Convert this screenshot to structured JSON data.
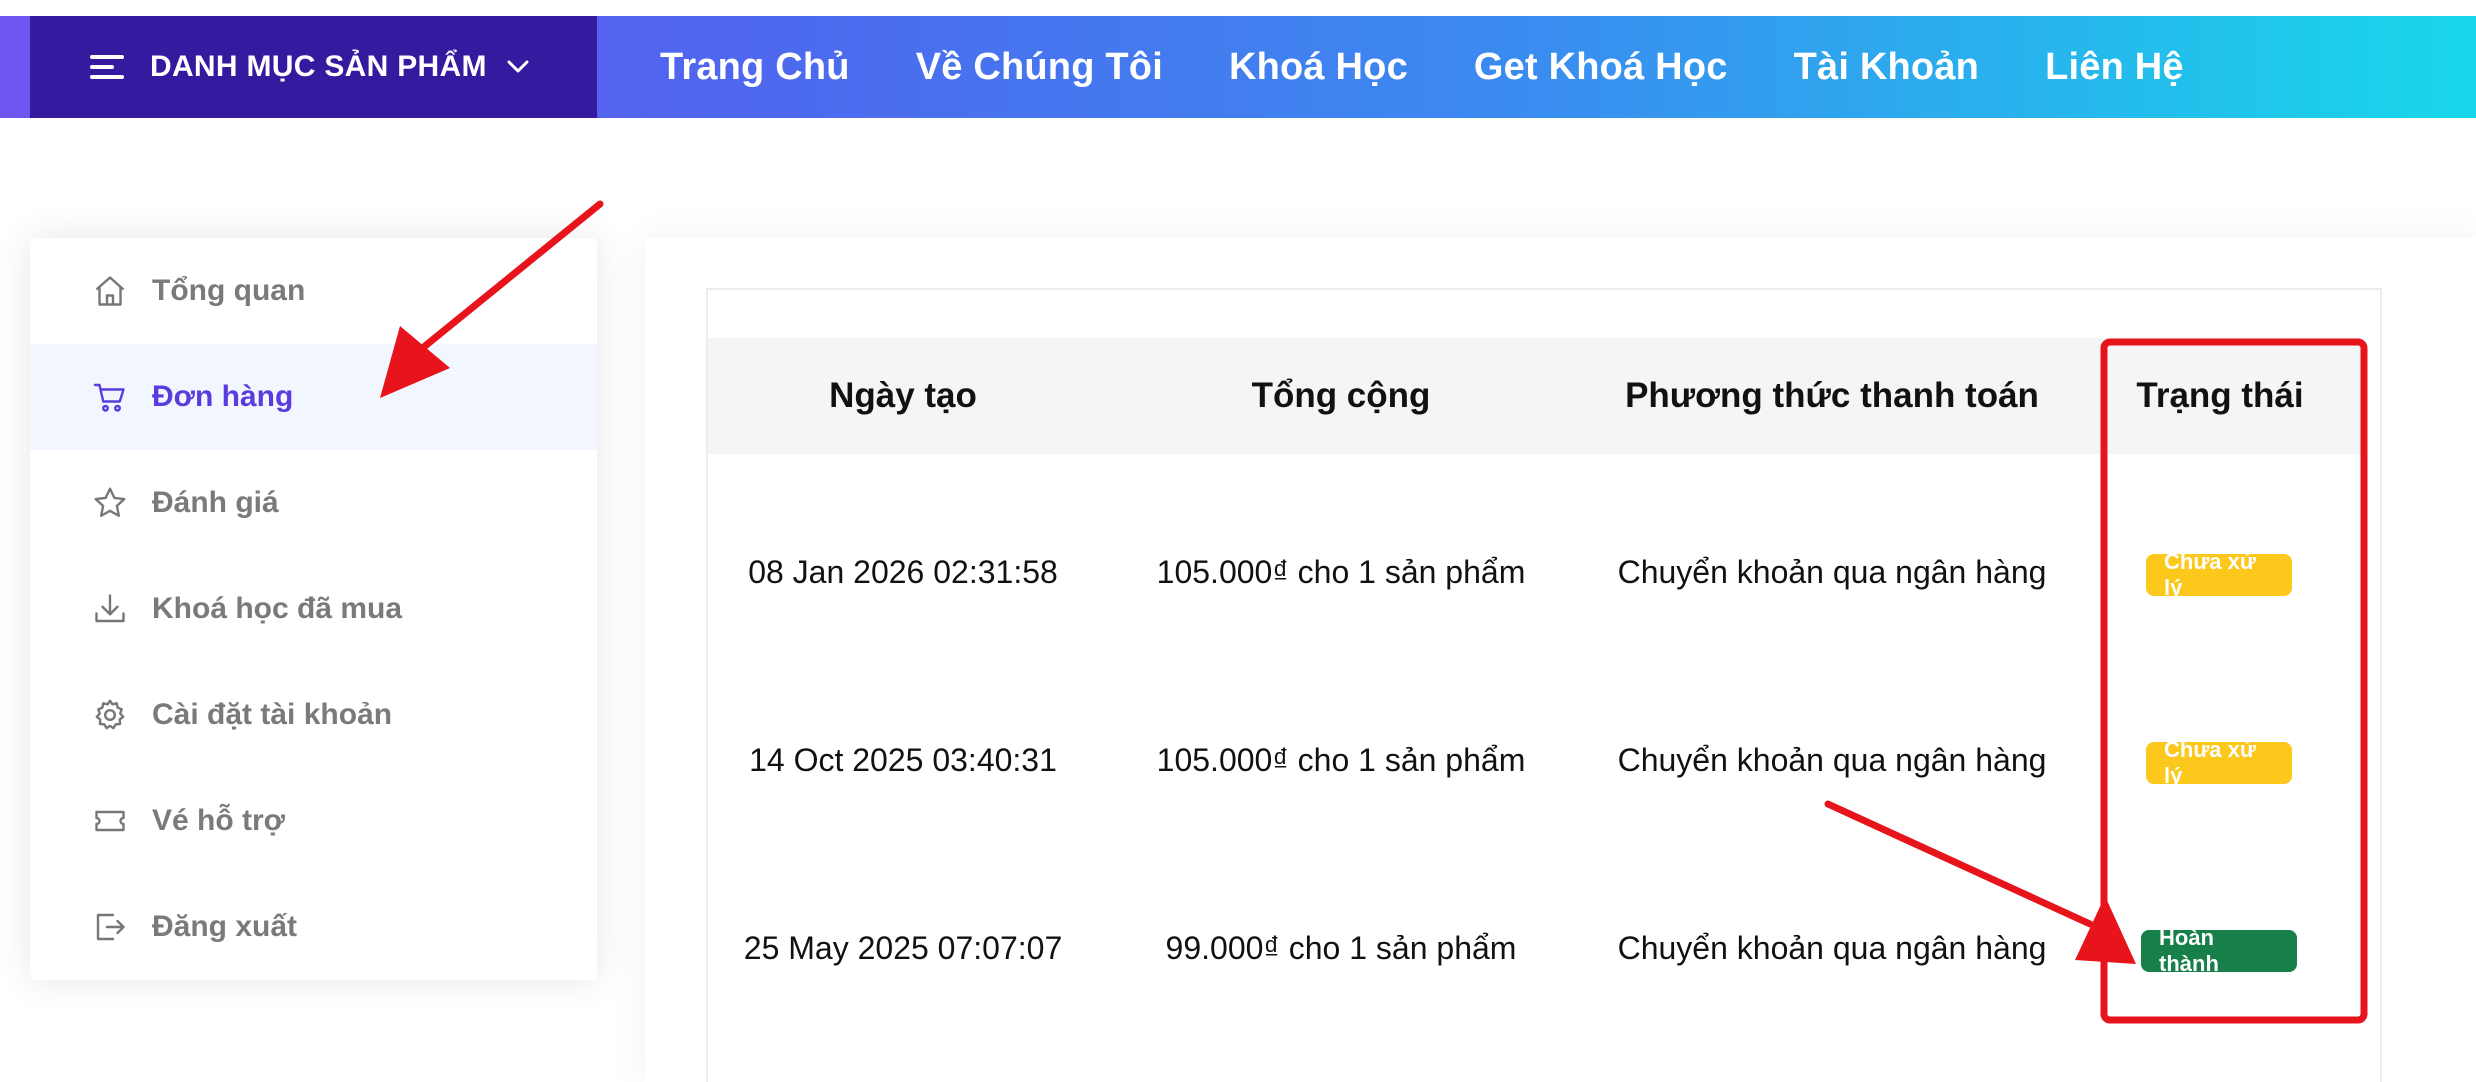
{
  "header": {
    "category_label": "DANH MỤC SẢN PHẨM",
    "nav": [
      "Trang Chủ",
      "Về Chúng Tôi",
      "Khoá Học",
      "Get Khoá Học",
      "Tài Khoản",
      "Liên Hệ"
    ]
  },
  "sidebar": {
    "items": [
      {
        "label": "Tổng quan",
        "icon": "home-icon"
      },
      {
        "label": "Đơn hàng",
        "icon": "cart-icon",
        "active": true
      },
      {
        "label": "Đánh giá",
        "icon": "star-icon"
      },
      {
        "label": "Khoá học đã mua",
        "icon": "download-icon"
      },
      {
        "label": "Cài đặt tài khoản",
        "icon": "gear-icon"
      },
      {
        "label": "Vé hỗ trợ",
        "icon": "ticket-icon"
      },
      {
        "label": "Đăng xuất",
        "icon": "logout-icon"
      }
    ]
  },
  "orders": {
    "columns": [
      "Ngày tạo",
      "Tổng cộng",
      "Phương thức thanh toán",
      "Trạng thái"
    ],
    "rows": [
      {
        "date": "08 Jan 2026 02:31:58",
        "total": "105.000₫ cho 1 sản phẩm",
        "payment": "Chuyển khoản qua ngân hàng",
        "status": "Chưa xử lý"
      },
      {
        "date": "14 Oct 2025 03:40:31",
        "total": "105.000₫ cho 1 sản phẩm",
        "payment": "Chuyển khoản qua ngân hàng",
        "status": "Chưa xử lý"
      },
      {
        "date": "25 May 2025 07:07:07",
        "total": "99.000₫ cho 1 sản phẩm",
        "payment": "Chuyển khoản qua ngân hàng",
        "status": "Hoàn thành"
      }
    ]
  },
  "colors": {
    "accent": "#5a3cde",
    "category_bg": "#35199e",
    "pending": "#fcc81c",
    "done": "#177f4a",
    "annotation": "#e8141b"
  }
}
